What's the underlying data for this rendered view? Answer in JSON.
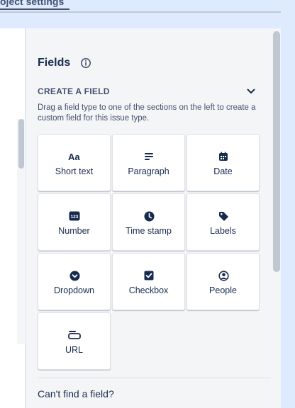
{
  "top": {
    "tab_label": "oject settings"
  },
  "panel": {
    "title": "Fields",
    "section_heading": "CREATE A FIELD",
    "description": "Drag a field type to one of the sections on the left to create a custom field for this issue type.",
    "footer_text": "Can't find a field?"
  },
  "field_types": [
    {
      "label": "Short text",
      "icon": "text-aa-icon"
    },
    {
      "label": "Paragraph",
      "icon": "paragraph-icon"
    },
    {
      "label": "Date",
      "icon": "calendar-icon"
    },
    {
      "label": "Number",
      "icon": "number-123-icon"
    },
    {
      "label": "Time stamp",
      "icon": "clock-icon"
    },
    {
      "label": "Labels",
      "icon": "tag-icon"
    },
    {
      "label": "Dropdown",
      "icon": "dropdown-icon"
    },
    {
      "label": "Checkbox",
      "icon": "checkbox-icon"
    },
    {
      "label": "People",
      "icon": "person-icon"
    },
    {
      "label": "URL",
      "icon": "link-icon"
    }
  ],
  "colors": {
    "page_bg": "#deebff",
    "panel_bg": "#f4f5f7",
    "card_bg": "#ffffff",
    "text": "#172b4d",
    "icon": "#172b4d"
  }
}
